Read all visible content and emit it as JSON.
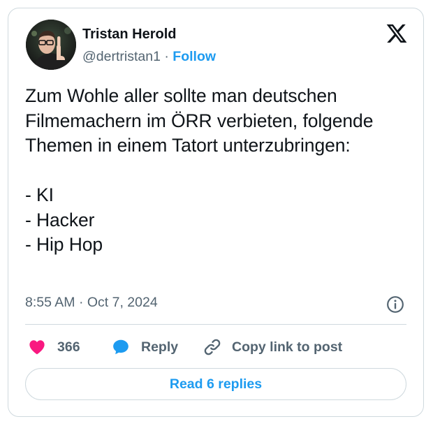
{
  "author": {
    "name": "Tristan Herold",
    "handle": "@dertristan1",
    "separator": "·",
    "follow_label": "Follow"
  },
  "tweet": {
    "text": "Zum Wohle aller sollte man deutschen Filmemachern im ÖRR verbieten, folgende Themen in einem Tatort unterzubringen:\n\n- KI\n- Hacker\n- Hip Hop",
    "timestamp": "8:55 AM · Oct 7, 2024"
  },
  "actions": {
    "like_count": "366",
    "reply_label": "Reply",
    "copy_link_label": "Copy link to post"
  },
  "replies_button": "Read 6 replies",
  "icons": {
    "logo": "x-logo-icon",
    "info": "info-icon",
    "like": "heart-icon",
    "reply": "speech-bubble-icon",
    "copy": "link-icon"
  },
  "colors": {
    "accent": "#1d9bf0",
    "like": "#f91880",
    "text": "#0f1419",
    "secondary": "#536471",
    "border": "#cfd9de"
  }
}
